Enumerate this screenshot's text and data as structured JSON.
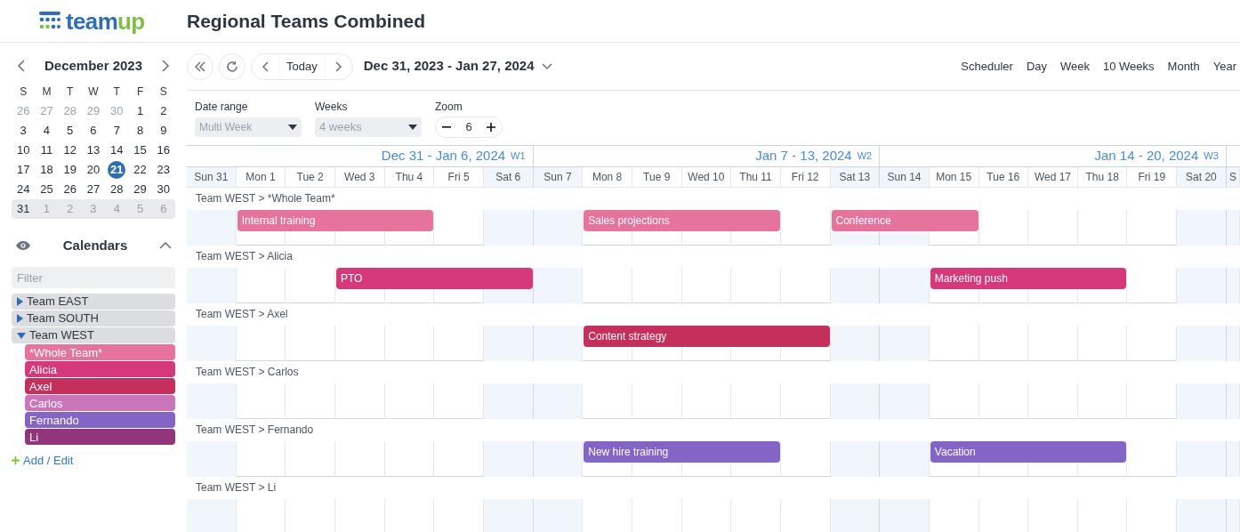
{
  "header": {
    "logo": [
      {
        "text": "team",
        "color": "#2f6db5"
      },
      {
        "text": "up",
        "color": "#7cc142"
      }
    ],
    "title": "Regional Teams Combined"
  },
  "mini_calendar": {
    "month": "December 2023",
    "weekdays": [
      "S",
      "M",
      "T",
      "W",
      "T",
      "F",
      "S"
    ],
    "weeks": [
      {
        "highlighted": false,
        "days": [
          {
            "text": "26",
            "muted": true,
            "selected": false
          },
          {
            "text": "27",
            "muted": true,
            "selected": false
          },
          {
            "text": "28",
            "muted": true,
            "selected": false
          },
          {
            "text": "29",
            "muted": true,
            "selected": false
          },
          {
            "text": "30",
            "muted": true,
            "selected": false
          },
          {
            "text": "1",
            "muted": false,
            "selected": false
          },
          {
            "text": "2",
            "muted": false,
            "selected": false
          }
        ]
      },
      {
        "highlighted": false,
        "days": [
          {
            "text": "3",
            "muted": false,
            "selected": false
          },
          {
            "text": "4",
            "muted": false,
            "selected": false
          },
          {
            "text": "5",
            "muted": false,
            "selected": false
          },
          {
            "text": "6",
            "muted": false,
            "selected": false
          },
          {
            "text": "7",
            "muted": false,
            "selected": false
          },
          {
            "text": "8",
            "muted": false,
            "selected": false
          },
          {
            "text": "9",
            "muted": false,
            "selected": false
          }
        ]
      },
      {
        "highlighted": false,
        "days": [
          {
            "text": "10",
            "muted": false,
            "selected": false
          },
          {
            "text": "11",
            "muted": false,
            "selected": false
          },
          {
            "text": "12",
            "muted": false,
            "selected": false
          },
          {
            "text": "13",
            "muted": false,
            "selected": false
          },
          {
            "text": "14",
            "muted": false,
            "selected": false
          },
          {
            "text": "15",
            "muted": false,
            "selected": false
          },
          {
            "text": "16",
            "muted": false,
            "selected": false
          }
        ]
      },
      {
        "highlighted": false,
        "days": [
          {
            "text": "17",
            "muted": false,
            "selected": false
          },
          {
            "text": "18",
            "muted": false,
            "selected": false
          },
          {
            "text": "19",
            "muted": false,
            "selected": false
          },
          {
            "text": "20",
            "muted": false,
            "selected": false
          },
          {
            "text": "21",
            "muted": false,
            "selected": true
          },
          {
            "text": "22",
            "muted": false,
            "selected": false
          },
          {
            "text": "23",
            "muted": false,
            "selected": false
          }
        ]
      },
      {
        "highlighted": false,
        "days": [
          {
            "text": "24",
            "muted": false,
            "selected": false
          },
          {
            "text": "25",
            "muted": false,
            "selected": false
          },
          {
            "text": "26",
            "muted": false,
            "selected": false
          },
          {
            "text": "27",
            "muted": false,
            "selected": false
          },
          {
            "text": "28",
            "muted": false,
            "selected": false
          },
          {
            "text": "29",
            "muted": false,
            "selected": false
          },
          {
            "text": "30",
            "muted": false,
            "selected": false
          }
        ]
      },
      {
        "highlighted": true,
        "days": [
          {
            "text": "31",
            "muted": false,
            "selected": false
          },
          {
            "text": "1",
            "muted": true,
            "selected": false
          },
          {
            "text": "2",
            "muted": true,
            "selected": false
          },
          {
            "text": "3",
            "muted": true,
            "selected": false
          },
          {
            "text": "4",
            "muted": true,
            "selected": false
          },
          {
            "text": "5",
            "muted": true,
            "selected": false
          },
          {
            "text": "6",
            "muted": true,
            "selected": false
          }
        ]
      }
    ]
  },
  "calendars": {
    "title": "Calendars",
    "expanded": true,
    "filter_placeholder": "Filter",
    "groups": [
      {
        "label": "Team EAST",
        "expanded": false
      },
      {
        "label": "Team SOUTH",
        "expanded": false
      },
      {
        "label": "Team WEST",
        "expanded": true,
        "children": [
          {
            "label": "*Whole Team*",
            "color": "#e5739b"
          },
          {
            "label": "Alicia",
            "color": "#d6397a"
          },
          {
            "label": "Axel",
            "color": "#c42f5c"
          },
          {
            "label": "Carlos",
            "color": "#ca74b9"
          },
          {
            "label": "Fernando",
            "color": "#8465c6"
          },
          {
            "label": "Li",
            "color": "#91367a"
          }
        ]
      }
    ],
    "add_link": "Add / Edit"
  },
  "toolbar": {
    "today": "Today",
    "date_range": "Dec 31, 2023 - Jan 27, 2024",
    "views": [
      "Scheduler",
      "Day",
      "Week",
      "10 Weeks",
      "Month",
      "Year"
    ]
  },
  "options": {
    "date_range": {
      "label": "Date range",
      "value": "Multi Week"
    },
    "weeks": {
      "label": "Weeks",
      "value": "4 weeks"
    },
    "zoom": {
      "label": "Zoom",
      "value": "6"
    }
  },
  "schedule": {
    "weeks": [
      {
        "label": "Dec 31 - Jan 6, 2024",
        "number": "W1"
      },
      {
        "label": "Jan 7 - 13, 2024",
        "number": "W2"
      },
      {
        "label": "Jan 14 - 20, 2024",
        "number": "W3"
      }
    ],
    "days": [
      {
        "text": "Sun 31",
        "weekend": true
      },
      {
        "text": "Mon 1",
        "weekend": false
      },
      {
        "text": "Tue 2",
        "weekend": false
      },
      {
        "text": "Wed 3",
        "weekend": false
      },
      {
        "text": "Thu 4",
        "weekend": false
      },
      {
        "text": "Fri 5",
        "weekend": false
      },
      {
        "text": "Sat 6",
        "weekend": true
      },
      {
        "text": "Sun 7",
        "weekend": true
      },
      {
        "text": "Mon 8",
        "weekend": false
      },
      {
        "text": "Tue 9",
        "weekend": false
      },
      {
        "text": "Wed 10",
        "weekend": false
      },
      {
        "text": "Thu 11",
        "weekend": false
      },
      {
        "text": "Fri 12",
        "weekend": false
      },
      {
        "text": "Sat 13",
        "weekend": true
      },
      {
        "text": "Sun 14",
        "weekend": true
      },
      {
        "text": "Mon 15",
        "weekend": false
      },
      {
        "text": "Tue 16",
        "weekend": false
      },
      {
        "text": "Wed 17",
        "weekend": false
      },
      {
        "text": "Thu 18",
        "weekend": false
      },
      {
        "text": "Fri 19",
        "weekend": false
      },
      {
        "text": "Sat 20",
        "weekend": true
      },
      {
        "text": "S",
        "weekend": true
      }
    ],
    "rows": [
      {
        "label": "Team WEST > *Whole Team*",
        "timeline": [
          {
            "kind": "empty"
          },
          {
            "kind": "event",
            "title": "Internal training",
            "color": "#e5739b"
          },
          {
            "kind": "continued"
          },
          {
            "kind": "continued"
          },
          {
            "kind": "continued"
          },
          {
            "kind": "empty"
          },
          {
            "kind": "empty"
          },
          {
            "kind": "empty"
          },
          {
            "kind": "event",
            "title": "Sales projections",
            "color": "#e5739b"
          },
          {
            "kind": "continued"
          },
          {
            "kind": "continued"
          },
          {
            "kind": "continued"
          },
          {
            "kind": "empty"
          },
          {
            "kind": "event",
            "title": "Conference",
            "color": "#e5739b"
          },
          {
            "kind": "continued"
          },
          {
            "kind": "continued"
          }
        ]
      },
      {
        "label": "Team WEST > Alicia",
        "timeline": [
          {
            "kind": "empty"
          },
          {
            "kind": "empty"
          },
          {
            "kind": "empty"
          },
          {
            "kind": "event",
            "title": "PTO",
            "color": "#d6397a"
          },
          {
            "kind": "continued"
          },
          {
            "kind": "continued"
          },
          {
            "kind": "continued"
          },
          {
            "kind": "empty"
          },
          {
            "kind": "empty"
          },
          {
            "kind": "empty"
          },
          {
            "kind": "empty"
          },
          {
            "kind": "empty"
          },
          {
            "kind": "empty"
          },
          {
            "kind": "empty"
          },
          {
            "kind": "empty"
          },
          {
            "kind": "event",
            "title": "Marketing push",
            "color": "#d6397a"
          },
          {
            "kind": "continued"
          },
          {
            "kind": "continued"
          },
          {
            "kind": "continued"
          }
        ]
      },
      {
        "label": "Team WEST > Axel",
        "timeline": [
          {
            "kind": "empty"
          },
          {
            "kind": "empty"
          },
          {
            "kind": "empty"
          },
          {
            "kind": "empty"
          },
          {
            "kind": "empty"
          },
          {
            "kind": "empty"
          },
          {
            "kind": "empty"
          },
          {
            "kind": "empty"
          },
          {
            "kind": "event",
            "title": "Content strategy",
            "color": "#c42f5c"
          },
          {
            "kind": "continued"
          },
          {
            "kind": "continued"
          },
          {
            "kind": "continued"
          },
          {
            "kind": "continued"
          }
        ]
      },
      {
        "label": "Team WEST > Carlos"
      },
      {
        "label": "Team WEST > Fernando",
        "timeline": [
          {
            "kind": "empty"
          },
          {
            "kind": "empty"
          },
          {
            "kind": "empty"
          },
          {
            "kind": "empty"
          },
          {
            "kind": "empty"
          },
          {
            "kind": "empty"
          },
          {
            "kind": "empty"
          },
          {
            "kind": "empty"
          },
          {
            "kind": "event",
            "title": "New hire training",
            "color": "#8465c6"
          },
          {
            "kind": "continued"
          },
          {
            "kind": "continued"
          },
          {
            "kind": "continued"
          },
          {
            "kind": "empty"
          },
          {
            "kind": "empty"
          },
          {
            "kind": "empty"
          },
          {
            "kind": "event",
            "title": "Vacation",
            "color": "#8465c6"
          },
          {
            "kind": "continued"
          },
          {
            "kind": "continued"
          },
          {
            "kind": "continued"
          }
        ]
      },
      {
        "label": "Team WEST > Li"
      }
    ]
  }
}
